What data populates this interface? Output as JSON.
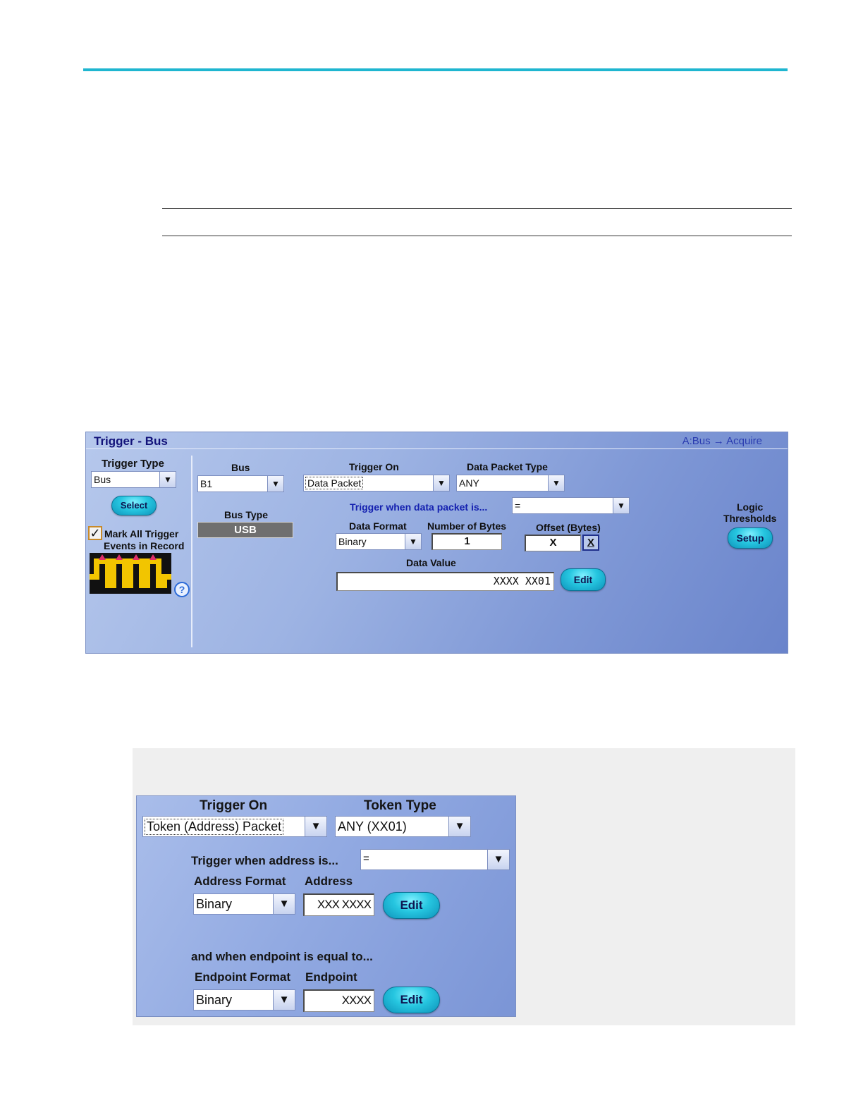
{
  "panel": {
    "title": "Trigger - Bus",
    "breadcrumb": "A:Bus → Acquire",
    "trigger_type": {
      "label": "Trigger Type",
      "value": "Bus"
    },
    "select_label": "Select",
    "mark_all": {
      "checked": true,
      "line1": "Mark All Trigger",
      "line2": "Events in Record"
    },
    "help_glyph": "?",
    "bus": {
      "label": "Bus",
      "value": "B1"
    },
    "bus_type": {
      "label": "Bus Type",
      "value": "USB"
    },
    "trigger_on": {
      "label": "Trigger On",
      "value": "Data Packet"
    },
    "data_packet_type": {
      "label": "Data Packet Type",
      "value": "ANY"
    },
    "trigger_when": {
      "label": "Trigger when data packet is...",
      "value": "="
    },
    "data_format": {
      "label": "Data Format",
      "value": "Binary"
    },
    "num_bytes": {
      "label": "Number of Bytes",
      "value": "1"
    },
    "offset": {
      "label": "Offset (Bytes)",
      "value": "X",
      "clear_label": "X"
    },
    "data_value": {
      "label": "Data Value",
      "value": "XXXX XX01",
      "edit_label": "Edit"
    },
    "logic_thresholds": {
      "line1": "Logic",
      "line2": "Thresholds",
      "setup_label": "Setup"
    }
  },
  "token_panel": {
    "trigger_on": {
      "label": "Trigger On",
      "value": "Token (Address) Packet"
    },
    "token_type": {
      "label": "Token Type",
      "value": "ANY (XX01)"
    },
    "trigger_when": {
      "label": "Trigger when address is...",
      "value": "="
    },
    "address_format": {
      "label": "Address Format",
      "value": "Binary"
    },
    "address": {
      "label": "Address",
      "value": "XXX XXXX",
      "edit_label": "Edit"
    },
    "endpoint_note": "and when endpoint is equal to...",
    "endpoint_format": {
      "label": "Endpoint Format",
      "value": "Binary"
    },
    "endpoint": {
      "label": "Endpoint",
      "value": "XXXX",
      "edit_label": "Edit"
    }
  },
  "icons": {
    "dropdown": "▼",
    "checkmark": "✓"
  },
  "colors": {
    "accent_bar": "#1fb6d0",
    "panel_title": "#12127a",
    "button": "#26c6e0"
  }
}
